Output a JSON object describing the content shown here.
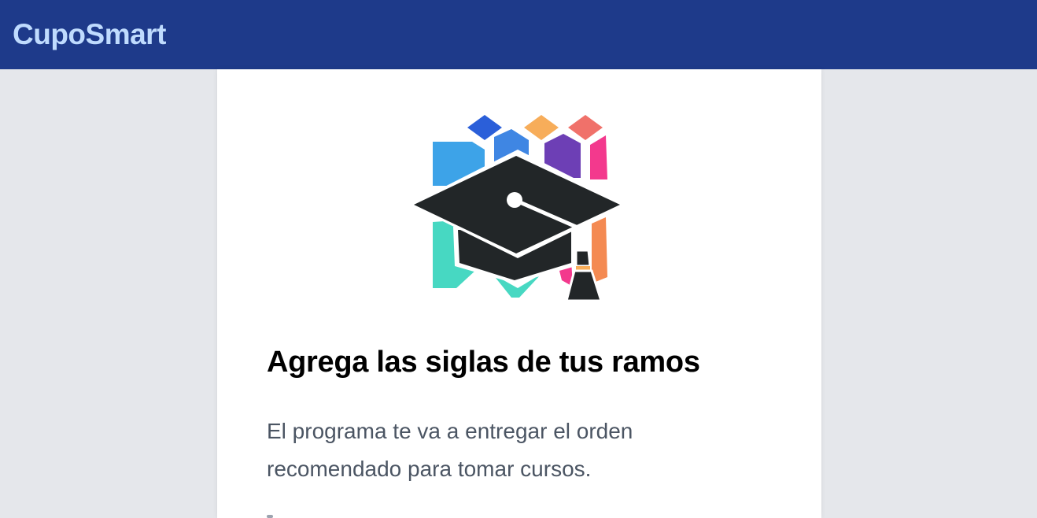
{
  "header": {
    "brand": "CupoSmart",
    "background_color": "#1e3a8a",
    "brand_color": "#bfdbfe"
  },
  "hero": {
    "illustration_icon": "graduation-cap-icon",
    "title": "Agrega las siglas de tus ramos",
    "description_line1": "El programa te va a entregar el orden",
    "description_line2": "recomendado para tomar cursos."
  },
  "colors": {
    "page_background": "#e5e7eb",
    "card_background": "#ffffff",
    "text_muted": "#4b5563"
  }
}
